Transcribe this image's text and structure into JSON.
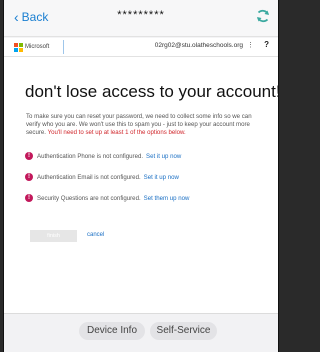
{
  "nav": {
    "back_label": "Back",
    "title_masked": "*********"
  },
  "ms_header": {
    "logo_text": "Microsoft",
    "account": "02rg02@stu.olatheschools.org",
    "more": "⋮",
    "help": "?"
  },
  "page": {
    "headline": "don't lose access to your account!",
    "intro": "To make sure you can reset your password, we need to collect some info so we can verify who you are. We won't use this to spam you - just to keep your account more secure.",
    "warning": "You'll need to set up at least 1 of the options below."
  },
  "items": [
    {
      "text": "Authentication Phone is not configured.",
      "link": "Set it up now"
    },
    {
      "text": "Authentication Email is not configured.",
      "link": "Set it up now"
    },
    {
      "text": "Security Questions are not configured.",
      "link": "Set them up now"
    }
  ],
  "actions": {
    "finish_label": "finish",
    "cancel_label": "cancel"
  },
  "bottom": {
    "device_info_label": "Device Info",
    "self_service_label": "Self-Service"
  },
  "colors": {
    "accent": "#1a7fd1",
    "warning": "#d0262b",
    "alert_icon": "#c2185b",
    "refresh_icon": "#3ba9a0"
  }
}
